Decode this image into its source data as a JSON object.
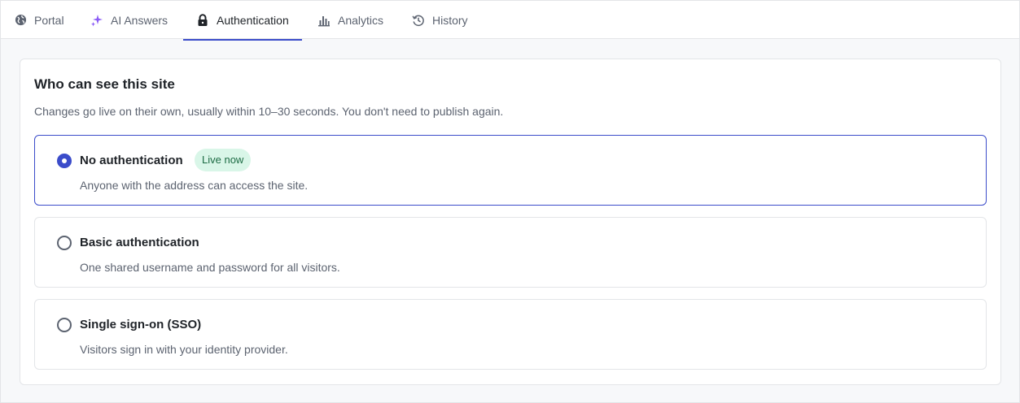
{
  "tabs": [
    {
      "label": "Portal",
      "icon": "globe-icon"
    },
    {
      "label": "AI Answers",
      "icon": "sparkle-icon"
    },
    {
      "label": "Authentication",
      "icon": "lock-icon",
      "active": true
    },
    {
      "label": "Analytics",
      "icon": "bar-chart-icon"
    },
    {
      "label": "History",
      "icon": "history-icon"
    }
  ],
  "colors": {
    "accent": "#3b4cca",
    "sparkle": "#8b5cf6",
    "badge_bg": "#d9f6e8",
    "badge_text": "#1c6b43"
  },
  "section": {
    "title": "Who can see this site",
    "description": "Changes go live on their own, usually within 10–30 seconds. You don't need to publish again."
  },
  "options": [
    {
      "title": "No authentication",
      "badge": "Live now",
      "description": "Anyone with the address can access the site.",
      "selected": true
    },
    {
      "title": "Basic authentication",
      "description": "One shared username and password for all visitors.",
      "selected": false
    },
    {
      "title": "Single sign-on (SSO)",
      "description": "Visitors sign in with your identity provider.",
      "selected": false
    }
  ]
}
